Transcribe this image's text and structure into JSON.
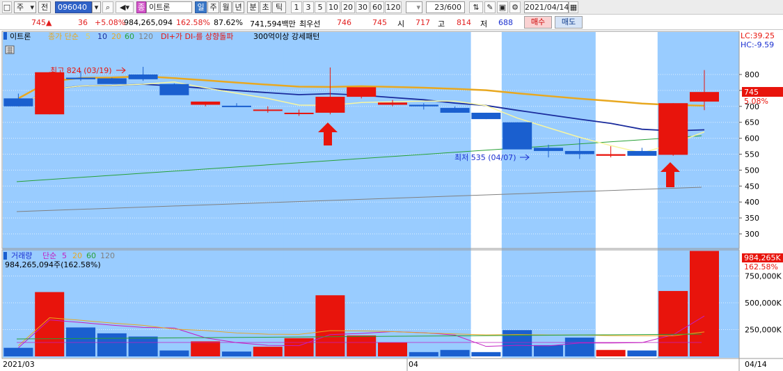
{
  "toolbar": {
    "period_select": "주",
    "prev_label": "전",
    "stock_code": "096040",
    "badge": "종",
    "stock_name": "이트론",
    "periods": [
      "일",
      "주",
      "월",
      "년",
      "분",
      "초",
      "틱"
    ],
    "intervals": [
      "1",
      "3",
      "5",
      "10",
      "20",
      "30",
      "60",
      "120"
    ],
    "count": "23/600",
    "date": "2021/04/14",
    "colors": {
      "active_period": "#3a78c8"
    }
  },
  "quote": {
    "price": "745",
    "change": "36",
    "change_pct": "+5.08%",
    "volume": "984,265,094",
    "volume_pct": "162.58%",
    "turnover_pct": "87.62%",
    "amount": "741,594백만",
    "best_label": "최우선",
    "best_ask": "746",
    "best_bid": "745",
    "open_label": "시",
    "open": "717",
    "high_label": "고",
    "high": "814",
    "low_label": "저",
    "low": "688",
    "buy_button": "매수",
    "sell_button": "매도"
  },
  "price_legend": {
    "name": "이트론",
    "ma_label": "종가 단순",
    "ma_periods": [
      "5",
      "10",
      "20",
      "60",
      "120"
    ],
    "signal": "DI+가 DI-를 상향돌파",
    "pattern": "300억이상 강세패턴"
  },
  "price_panel": {
    "lc": "LC:39.25",
    "hc": "HC:-9.59",
    "last_price_tag": "745",
    "last_change_tag": "5.08%",
    "high_annotation": "최고 824 (03/19)",
    "low_annotation": "최저 535 (04/07)",
    "y_ticks": [
      "800",
      "750",
      "700",
      "650",
      "600",
      "550",
      "500",
      "450",
      "400",
      "350",
      "300"
    ]
  },
  "volume_legend": {
    "name": "거래량",
    "ma_label": "단순",
    "ma_periods": [
      "5",
      "20",
      "60",
      "120"
    ],
    "current": "984,265,094주(162.58%)"
  },
  "volume_panel": {
    "last_tag": "984,265K",
    "last_pct_tag": "162.58%",
    "y_ticks": [
      "750,000K",
      "500,000K",
      "250,000K"
    ]
  },
  "x_axis": {
    "start": "2021/03",
    "mid": "04",
    "end": "04/14"
  },
  "chart_data": {
    "type": "candlestick",
    "dates": [
      "03/15",
      "03/16",
      "03/17",
      "03/18",
      "03/19",
      "03/22",
      "03/23",
      "03/24",
      "03/25",
      "03/26",
      "03/29",
      "03/30",
      "03/31",
      "04/01",
      "04/02",
      "04/05",
      "04/06",
      "04/07",
      "04/08",
      "04/09",
      "04/12",
      "04/13",
      "04/14"
    ],
    "ohlc": [
      [
        725,
        740,
        700,
        700
      ],
      [
        675,
        808,
        675,
        807
      ],
      [
        790,
        810,
        780,
        785
      ],
      [
        788,
        790,
        770,
        770
      ],
      [
        800,
        824,
        780,
        785
      ],
      [
        770,
        772,
        750,
        735
      ],
      [
        705,
        715,
        700,
        715
      ],
      [
        702,
        710,
        700,
        700
      ],
      [
        690,
        700,
        680,
        690
      ],
      [
        680,
        690,
        670,
        680
      ],
      [
        680,
        822,
        675,
        730
      ],
      [
        730,
        755,
        725,
        760
      ],
      [
        705,
        720,
        700,
        712
      ],
      [
        705,
        710,
        690,
        700
      ],
      [
        695,
        700,
        680,
        680
      ],
      [
        680,
        680,
        660,
        660
      ],
      [
        650,
        650,
        600,
        565
      ],
      [
        570,
        580,
        540,
        560
      ],
      [
        560,
        600,
        535,
        550
      ],
      [
        545,
        575,
        540,
        550
      ],
      [
        560,
        570,
        555,
        545
      ],
      [
        548,
        710,
        545,
        710
      ],
      [
        715,
        814,
        688,
        745
      ]
    ],
    "volume_k": [
      80,
      600,
      270,
      215,
      185,
      55,
      140,
      45,
      90,
      170,
      570,
      195,
      130,
      40,
      60,
      40,
      245,
      105,
      175,
      60,
      55,
      610,
      984
    ],
    "y_range": [
      270,
      835
    ],
    "volume_range": [
      0,
      1000000
    ],
    "colors": {
      "up": "#e8140c",
      "down": "#1a5fcf",
      "ma5": "#f8f6a0",
      "ma10": "#1a2b9c",
      "ma20": "#e8a820",
      "ma60": "#26a035",
      "ma120": "#808080"
    }
  }
}
